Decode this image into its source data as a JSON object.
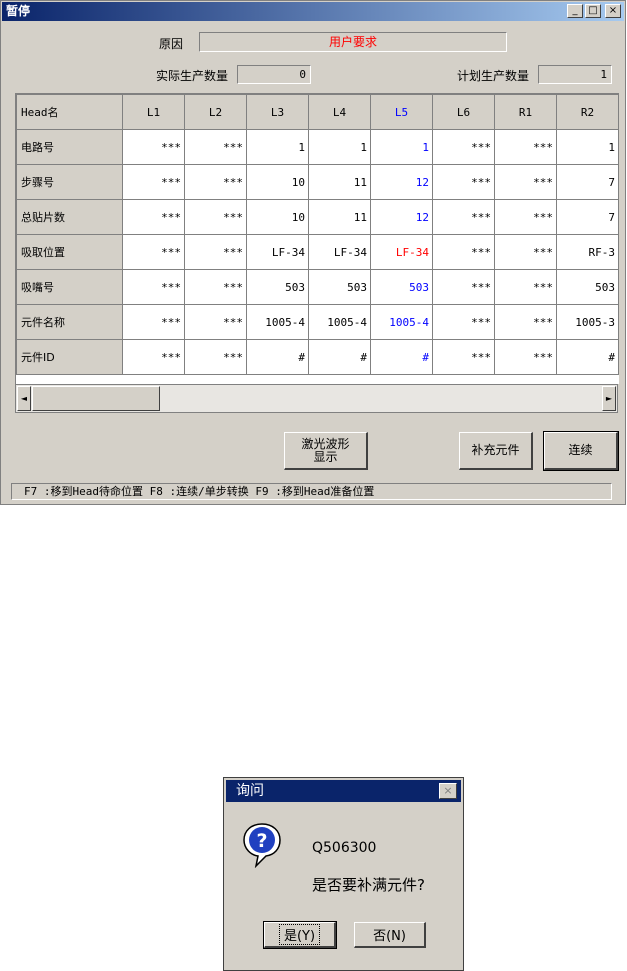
{
  "window": {
    "title": "暂停",
    "minimize": "_",
    "maximize": "□",
    "close": "×"
  },
  "reason": {
    "label": "原因",
    "value": "用户要求"
  },
  "actual_count": {
    "label": "实际生产数量",
    "value": "0"
  },
  "plan_count": {
    "label": "计划生产数量",
    "value": "1"
  },
  "grid": {
    "corner": "Head名",
    "columns": [
      "L1",
      "L2",
      "L3",
      "L4",
      "L5",
      "L6",
      "R1",
      "R2"
    ],
    "highlight_column": "L5",
    "rows": [
      {
        "label": "电路号",
        "cells": [
          "***",
          "***",
          "1",
          "1",
          "1",
          "***",
          "***",
          "1"
        ]
      },
      {
        "label": "步骤号",
        "cells": [
          "***",
          "***",
          "10",
          "11",
          "12",
          "***",
          "***",
          "7"
        ]
      },
      {
        "label": "总贴片数",
        "cells": [
          "***",
          "***",
          "10",
          "11",
          "12",
          "***",
          "***",
          "7"
        ]
      },
      {
        "label": "吸取位置",
        "cells": [
          "***",
          "***",
          "LF-34",
          "LF-34",
          "LF-34",
          "***",
          "***",
          "RF-3"
        ]
      },
      {
        "label": "吸嘴号",
        "cells": [
          "***",
          "***",
          "503",
          "503",
          "503",
          "***",
          "***",
          "503"
        ]
      },
      {
        "label": "元件名称",
        "cells": [
          "***",
          "***",
          "1005-4",
          "1005-4",
          "1005-4",
          "***",
          "***",
          "1005-3"
        ]
      },
      {
        "label": "元件ID",
        "cells": [
          "***",
          "***",
          "#",
          "#",
          "#",
          "***",
          "***",
          "#"
        ]
      }
    ],
    "colors": {
      "highlight": "#0000ff",
      "alert": "#ff0000"
    }
  },
  "scroll": {
    "left_arrow": "◄",
    "right_arrow": "►"
  },
  "buttons": {
    "laser_line1": "激光波形",
    "laser_line2": "显示",
    "refill": "补充元件",
    "continue": "连续"
  },
  "status_text": "F7 :移到Head待命位置  F8 :连续/单步转换  F9 :移到Head准备位置",
  "dialog": {
    "title": "询问",
    "close": "×",
    "code": "Q506300",
    "message": "是否要补满元件?",
    "yes": "是(Y)",
    "no": "否(N)"
  }
}
